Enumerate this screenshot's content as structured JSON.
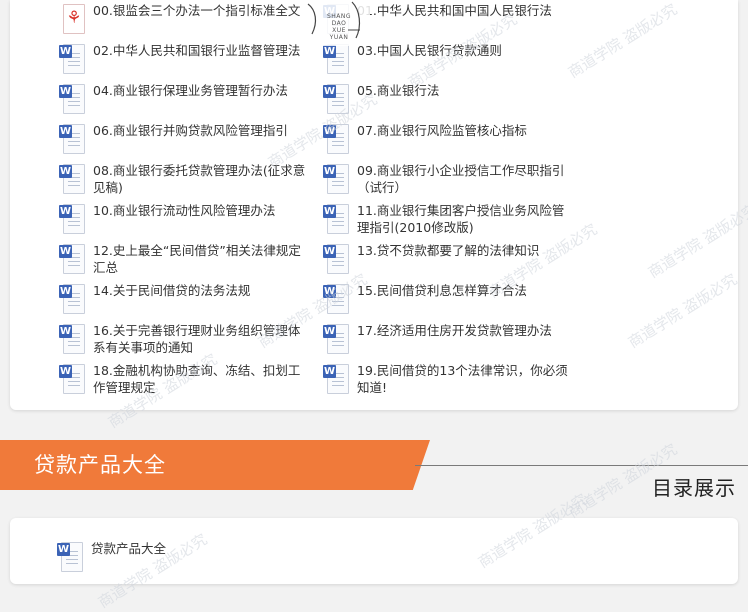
{
  "files": [
    {
      "label": "00.银监会三个办法一个指引标准全文",
      "icon": "pdf-icon"
    },
    {
      "label": "01.中华人民共和国中国人民银行法",
      "icon": "word-icon"
    },
    {
      "label": "02.中华人民共和国银行业监督管理法",
      "icon": "word-icon"
    },
    {
      "label": "03.中国人民银行贷款通则",
      "icon": "word-icon"
    },
    {
      "label": "04.商业银行保理业务管理暂行办法",
      "icon": "word-icon"
    },
    {
      "label": "05.商业银行法",
      "icon": "word-icon"
    },
    {
      "label": "06.商业银行并购贷款风险管理指引",
      "icon": "word-icon"
    },
    {
      "label": "07.商业银行风险监管核心指标",
      "icon": "word-icon"
    },
    {
      "label": "08.商业银行委托贷款管理办法(征求意见稿)",
      "icon": "word-icon"
    },
    {
      "label": "09.商业银行小企业授信工作尽职指引（试行）",
      "icon": "word-icon"
    },
    {
      "label": "10.商业银行流动性风险管理办法",
      "icon": "word-icon"
    },
    {
      "label": "11.商业银行集团客户授信业务风险管理指引(2010修改版)",
      "icon": "word-icon"
    },
    {
      "label": "12.史上最全“民间借贷”相关法律规定汇总",
      "icon": "word-icon"
    },
    {
      "label": "13.贷不贷款都要了解的法律知识",
      "icon": "word-icon"
    },
    {
      "label": "14.关于民间借贷的法务法规",
      "icon": "word-icon"
    },
    {
      "label": "15.民间借贷利息怎样算才合法",
      "icon": "word-icon"
    },
    {
      "label": "16.关于完善银行理财业务组织管理体系有关事项的通知",
      "icon": "word-icon"
    },
    {
      "label": "17.经济适用住房开发贷款管理办法",
      "icon": "word-icon"
    },
    {
      "label": "18.金融机构协助查询、冻结、扣划工作管理规定",
      "icon": "word-icon"
    },
    {
      "label": "19.民间借贷的13个法律常识，你必须知道!",
      "icon": "word-icon"
    }
  ],
  "section": {
    "title": "贷款产品大全",
    "toc_label": "目录展示"
  },
  "bottom_files": [
    {
      "label": "贷款产品大全",
      "icon": "word-icon"
    }
  ],
  "stamp": {
    "line1": "SHANG DAO",
    "line2": "XUE YUAN"
  },
  "watermark": {
    "text": "商道学院 盗版必究"
  },
  "colors": {
    "accent": "#f07a3a",
    "word_blue": "#3b63b6",
    "pdf_red": "#d9332b"
  }
}
